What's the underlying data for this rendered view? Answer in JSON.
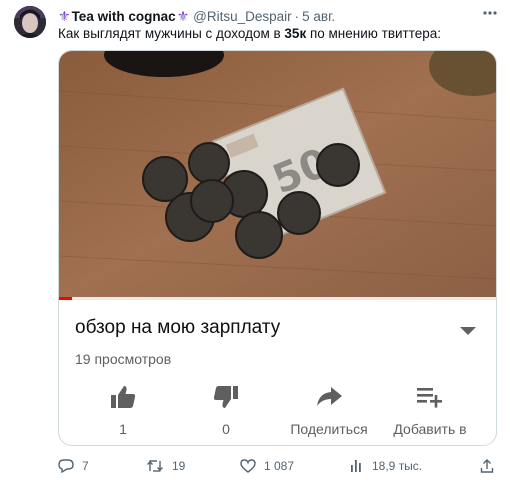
{
  "tweet": {
    "author_name": "Tea with cognac",
    "fleur_left": "⚜",
    "fleur_right": "⚜",
    "handle": "@Ritsu_Despair",
    "separator": "·",
    "date": "5 авг.",
    "text_before": "Как выглядят мужчины с доходом в ",
    "text_bold": "35к",
    "text_after": " по мнению твиттера:"
  },
  "video_card": {
    "title": "обзор на мою зарплату",
    "views": "19 просмотров",
    "progress": 0.03,
    "buttons": [
      {
        "icon": "thumbs-up-icon",
        "label": "1"
      },
      {
        "icon": "thumbs-down-icon",
        "label": "0"
      },
      {
        "icon": "share-arrow-icon",
        "label": "Поделиться"
      },
      {
        "icon": "add-to-playlist-icon",
        "label": "Добавить в"
      }
    ]
  },
  "actions": {
    "replies": "7",
    "retweets": "19",
    "likes": "1 087",
    "views": "18,9 тыс."
  },
  "colors": {
    "text": "#0f1419",
    "secondary": "#536471",
    "fleur": "#7a4bc6",
    "progress": "#ff0000",
    "yt_icon": "#5f5f5f"
  }
}
